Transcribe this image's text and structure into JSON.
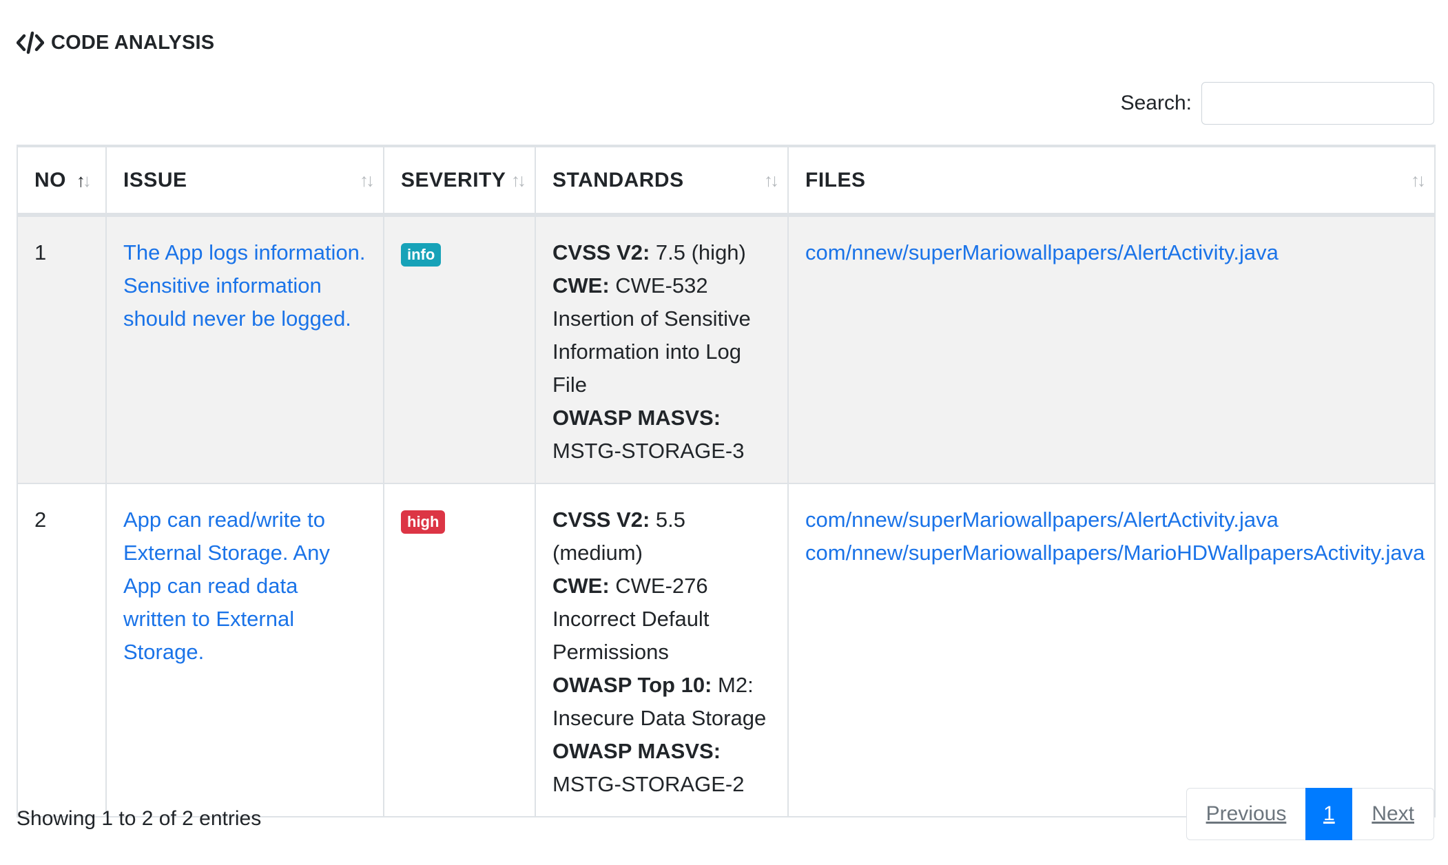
{
  "section": {
    "title": "CODE ANALYSIS",
    "icon": "code-icon"
  },
  "search": {
    "label": "Search:",
    "value": "",
    "placeholder": ""
  },
  "table": {
    "columns": [
      "NO",
      "ISSUE",
      "SEVERITY",
      "STANDARDS",
      "FILES"
    ],
    "sort": {
      "column": "NO",
      "direction": "ascending"
    },
    "rows": [
      {
        "no": "1",
        "issue": "The App logs information. Sensitive information should never be logged.",
        "severity": "info",
        "standards": [
          {
            "label": "CVSS V2:",
            "value": "7.5 (high)"
          },
          {
            "label": "CWE:",
            "value": "CWE-532 Insertion of Sensitive Information into Log File"
          },
          {
            "label": "OWASP MASVS:",
            "value": "MSTG-STORAGE-3"
          }
        ],
        "files": [
          "com/nnew/superMariowallpapers/AlertActivity.java"
        ]
      },
      {
        "no": "2",
        "issue": "App can read/write to External Storage. Any App can read data written to External Storage.",
        "severity": "high",
        "standards": [
          {
            "label": "CVSS V2:",
            "value": "5.5 (medium)"
          },
          {
            "label": "CWE:",
            "value": "CWE-276 Incorrect Default Permissions"
          },
          {
            "label": "OWASP Top 10:",
            "value": "M2: Insecure Data Storage"
          },
          {
            "label": "OWASP MASVS:",
            "value": "MSTG-STORAGE-2"
          }
        ],
        "files": [
          "com/nnew/superMariowallpapers/AlertActivity.java",
          "com/nnew/superMariowallpapers/MarioHDWallpapersActivity.java"
        ]
      }
    ]
  },
  "footer": {
    "info": "Showing 1 to 2 of 2 entries",
    "pagination": {
      "previous": "Previous",
      "current_page": "1",
      "next": "Next"
    }
  },
  "colors": {
    "link": "#1a73e8",
    "badge_info": "#17a2b8",
    "badge_high": "#dc3545",
    "pager_active": "#007bff",
    "row_stripe": "#f2f2f2"
  }
}
